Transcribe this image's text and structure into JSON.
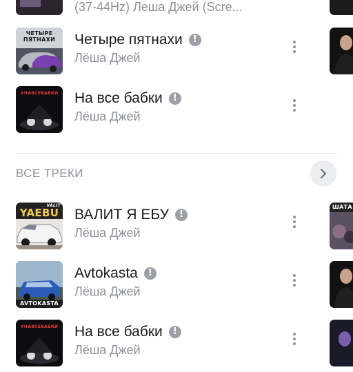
{
  "top_partial": {
    "text": "(37-44Hz) Леша Джей (Scre..."
  },
  "tracks_top": [
    {
      "title": "Четыре пятнахи",
      "artist": "Лёша Джей",
      "cover_text": "ЧЕТЫРЕ ПЯТНАХИ"
    },
    {
      "title": "На все бабки",
      "artist": "Лёша Джей",
      "cover_text": "#НАВСЕБАБКИ"
    }
  ],
  "section": {
    "title": "ВСЕ ТРЕКИ"
  },
  "tracks_all": [
    {
      "title": "ВАЛИТ Я ЕБУ",
      "artist": "Лёша Джей",
      "cover_text": "YAEBU",
      "cover_text2": "VALIT"
    },
    {
      "title": "Avtokasta",
      "artist": "Лёша Джей",
      "cover_text": "AVTOKASTA"
    },
    {
      "title": "На все бабки",
      "artist": "Лёша Джей",
      "cover_text": "#НАВСЕБАБКИ"
    }
  ],
  "side_covers": {
    "label_1": "ШАТА"
  },
  "icons": {
    "explicit": "!",
    "more": "more-vertical-icon",
    "chevron": "chevron-right-icon"
  },
  "colors": {
    "title": "#1a1a1a",
    "secondary": "#8c9096",
    "explicit_badge": "#9ba0a6",
    "chevron_bg": "#ebedf0",
    "divider": "#e4e6ea"
  }
}
